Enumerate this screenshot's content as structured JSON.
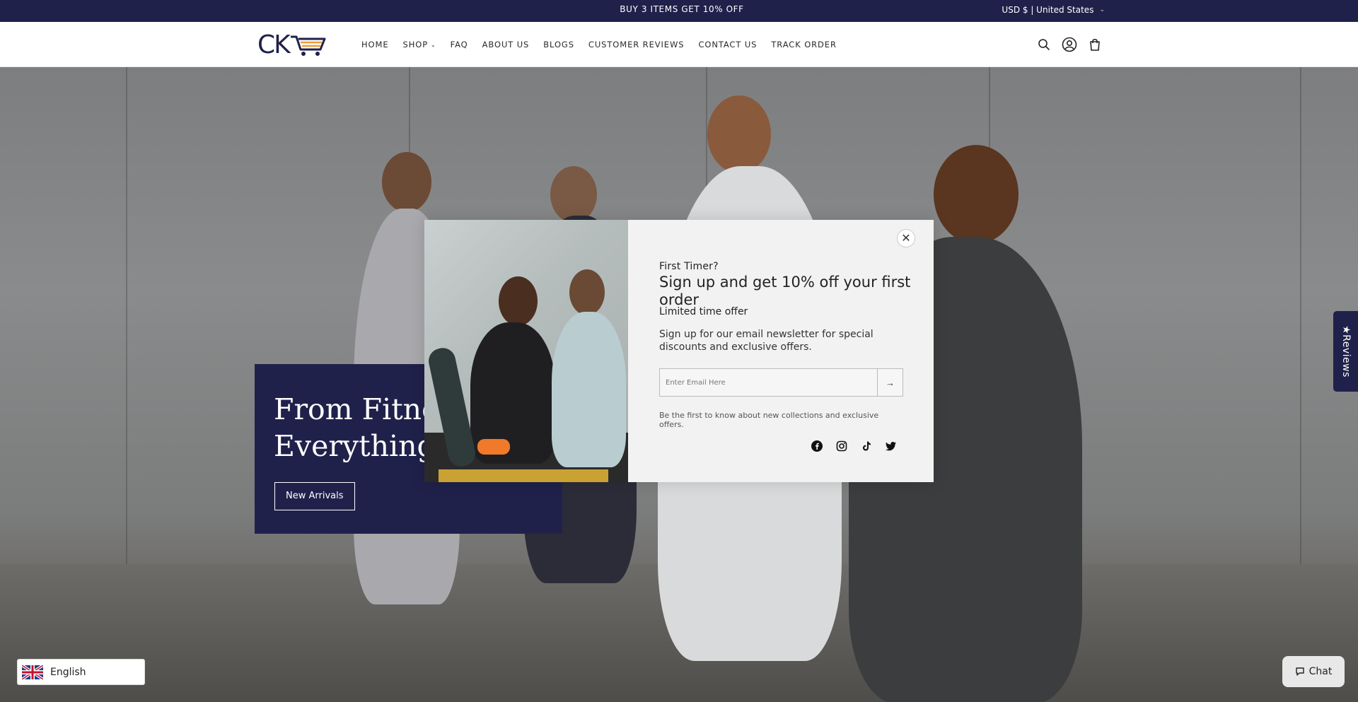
{
  "announcement": {
    "text": "BUY 3 ITEMS GET 10% OFF"
  },
  "currency": {
    "label": "USD $ | United States"
  },
  "header": {
    "logo_text": "CK",
    "nav": [
      {
        "label": "HOME"
      },
      {
        "label": "SHOP"
      },
      {
        "label": "FAQ"
      },
      {
        "label": "ABOUT US"
      },
      {
        "label": "BLOGS"
      },
      {
        "label": "CUSTOMER REVIEWS"
      },
      {
        "label": "CONTACT US"
      },
      {
        "label": "TRACK ORDER"
      }
    ],
    "icons": [
      "search-icon",
      "account-icon",
      "cart-icon"
    ]
  },
  "hero": {
    "title_line1": "From Fitnes",
    "title_line2": "Everything Y",
    "button_label": "New Arrivals"
  },
  "popup": {
    "first_timer": "First Timer?",
    "headline": "Sign up and get 10% off your first order",
    "limited": "Limited time offer",
    "description": "Sign up for our email newsletter for special discounts and exclusive offers.",
    "email_placeholder": "Enter Email Here",
    "fine_print": "Be the first to know about new collections and exclusive offers.",
    "socials": [
      "facebook-icon",
      "instagram-icon",
      "tiktok-icon",
      "twitter-icon"
    ]
  },
  "reviews_tab": {
    "label": "★Reviews"
  },
  "language": {
    "label": "English"
  },
  "chat": {
    "label": "Chat"
  },
  "colors": {
    "brand_navy": "#20214b",
    "popup_bg": "#f2f2f2",
    "white": "#ffffff"
  }
}
